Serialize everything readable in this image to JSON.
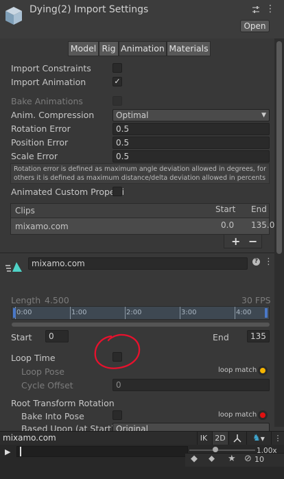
{
  "header": {
    "title": "Dying(2) Import Settings",
    "open_label": "Open"
  },
  "tabs": [
    {
      "label": "Model"
    },
    {
      "label": "Rig"
    },
    {
      "label": "Animation"
    },
    {
      "label": "Materials"
    }
  ],
  "fields": {
    "import_constraints": "Import Constraints",
    "import_animation": "Import Animation",
    "bake_animations": "Bake Animations",
    "anim_compression": "Anim. Compression",
    "anim_compression_value": "Optimal",
    "rotation_error": "Rotation Error",
    "rotation_error_value": "0.5",
    "position_error": "Position Error",
    "position_error_value": "0.5",
    "scale_error": "Scale Error",
    "scale_error_value": "0.5",
    "help_line1": "Rotation error is defined as maximum angle deviation allowed in degrees, for",
    "help_line2": "others it is defined as maximum distance/delta deviation allowed in percents",
    "animated_custom": "Animated Custom Properti"
  },
  "clips_table": {
    "header": "Clips",
    "col_start": "Start",
    "col_end": "End",
    "rows": [
      {
        "name": "mixamo.com",
        "start": "0.0",
        "end": "135.0"
      }
    ],
    "add": "+",
    "remove": "−"
  },
  "clip": {
    "name": "mixamo.com",
    "length_label": "Length",
    "length_value": "4.500",
    "fps": "30 FPS",
    "timeline_ticks": [
      "0:00",
      "1:00",
      "2:00",
      "3:00",
      "4:00"
    ],
    "start_label": "Start",
    "start_value": "0",
    "end_label": "End",
    "end_value": "135"
  },
  "loop": {
    "loop_time": "Loop Time",
    "loop_pose": "Loop Pose",
    "loop_match": "loop match",
    "cycle_offset": "Cycle Offset",
    "cycle_offset_value": "0"
  },
  "root_rotation": {
    "title": "Root Transform Rotation",
    "bake_into_pose": "Bake Into Pose",
    "loop_match": "loop match",
    "based_upon": "Based Upon (at Start)",
    "based_upon_value": "Original"
  },
  "preview": {
    "name": "mixamo.com",
    "ik": "IK",
    "two_d": "2D",
    "speed": "1.00x",
    "counter": "10"
  },
  "colors": {
    "status_ok": "#f5b400",
    "status_bad": "#e01010",
    "annotation": "#e8112d",
    "accent": "#3fa7d0"
  }
}
